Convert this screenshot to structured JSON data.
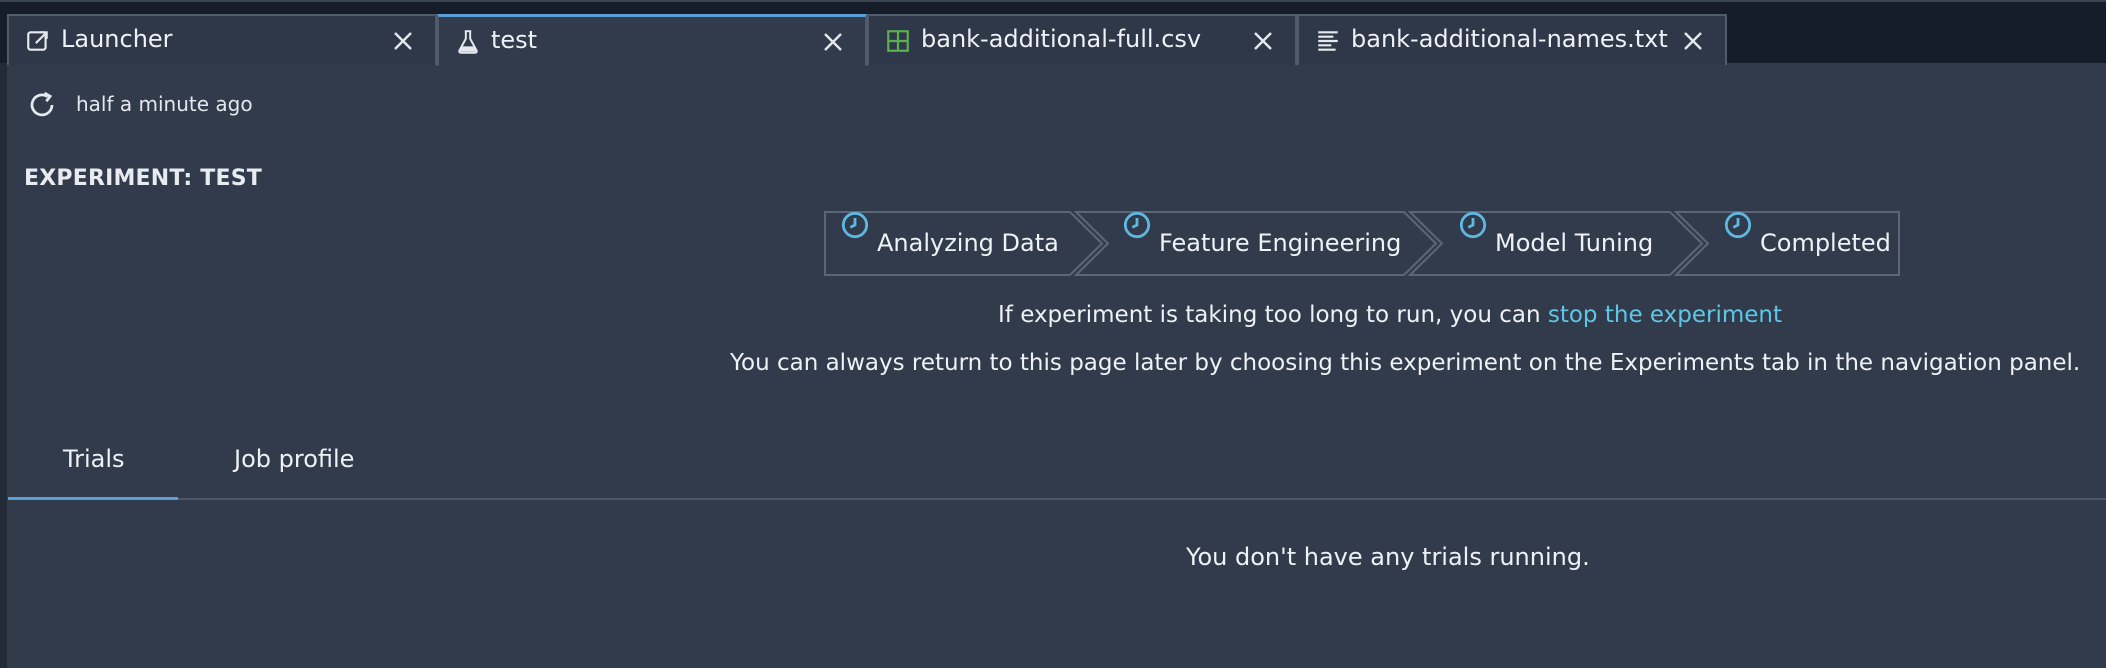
{
  "tabs": [
    {
      "label": "Launcher",
      "icon": "launcher-icon",
      "active": false
    },
    {
      "label": "test",
      "icon": "flask-icon",
      "active": true
    },
    {
      "label": "bank-additional-full.csv",
      "icon": "table-icon",
      "active": false
    },
    {
      "label": "bank-additional-names.txt",
      "icon": "text-file-icon",
      "active": false
    }
  ],
  "refresh": {
    "text": "half a minute ago"
  },
  "experiment": {
    "title": "EXPERIMENT: TEST"
  },
  "steps": [
    {
      "label": "Analyzing Data"
    },
    {
      "label": "Feature Engineering"
    },
    {
      "label": "Model Tuning"
    },
    {
      "label": "Completed"
    }
  ],
  "notes": {
    "long_run_prefix": "If experiment is taking too long to run, you can ",
    "stop_link": "stop the experiment",
    "return_text": "You can always return to this page later by choosing this experiment on the Experiments tab in the navigation panel."
  },
  "content_tabs": [
    {
      "label": "Trials",
      "active": true
    },
    {
      "label": "Job profile",
      "active": false
    }
  ],
  "trials": {
    "empty_message": "You don't have any trials running."
  },
  "colors": {
    "background": "#313b4b",
    "tabbar": "#161d2a",
    "accent": "#5b9fd6",
    "link": "#60c6e6",
    "step_icon": "#5fb8e0",
    "csv_icon": "#5bb04f"
  }
}
